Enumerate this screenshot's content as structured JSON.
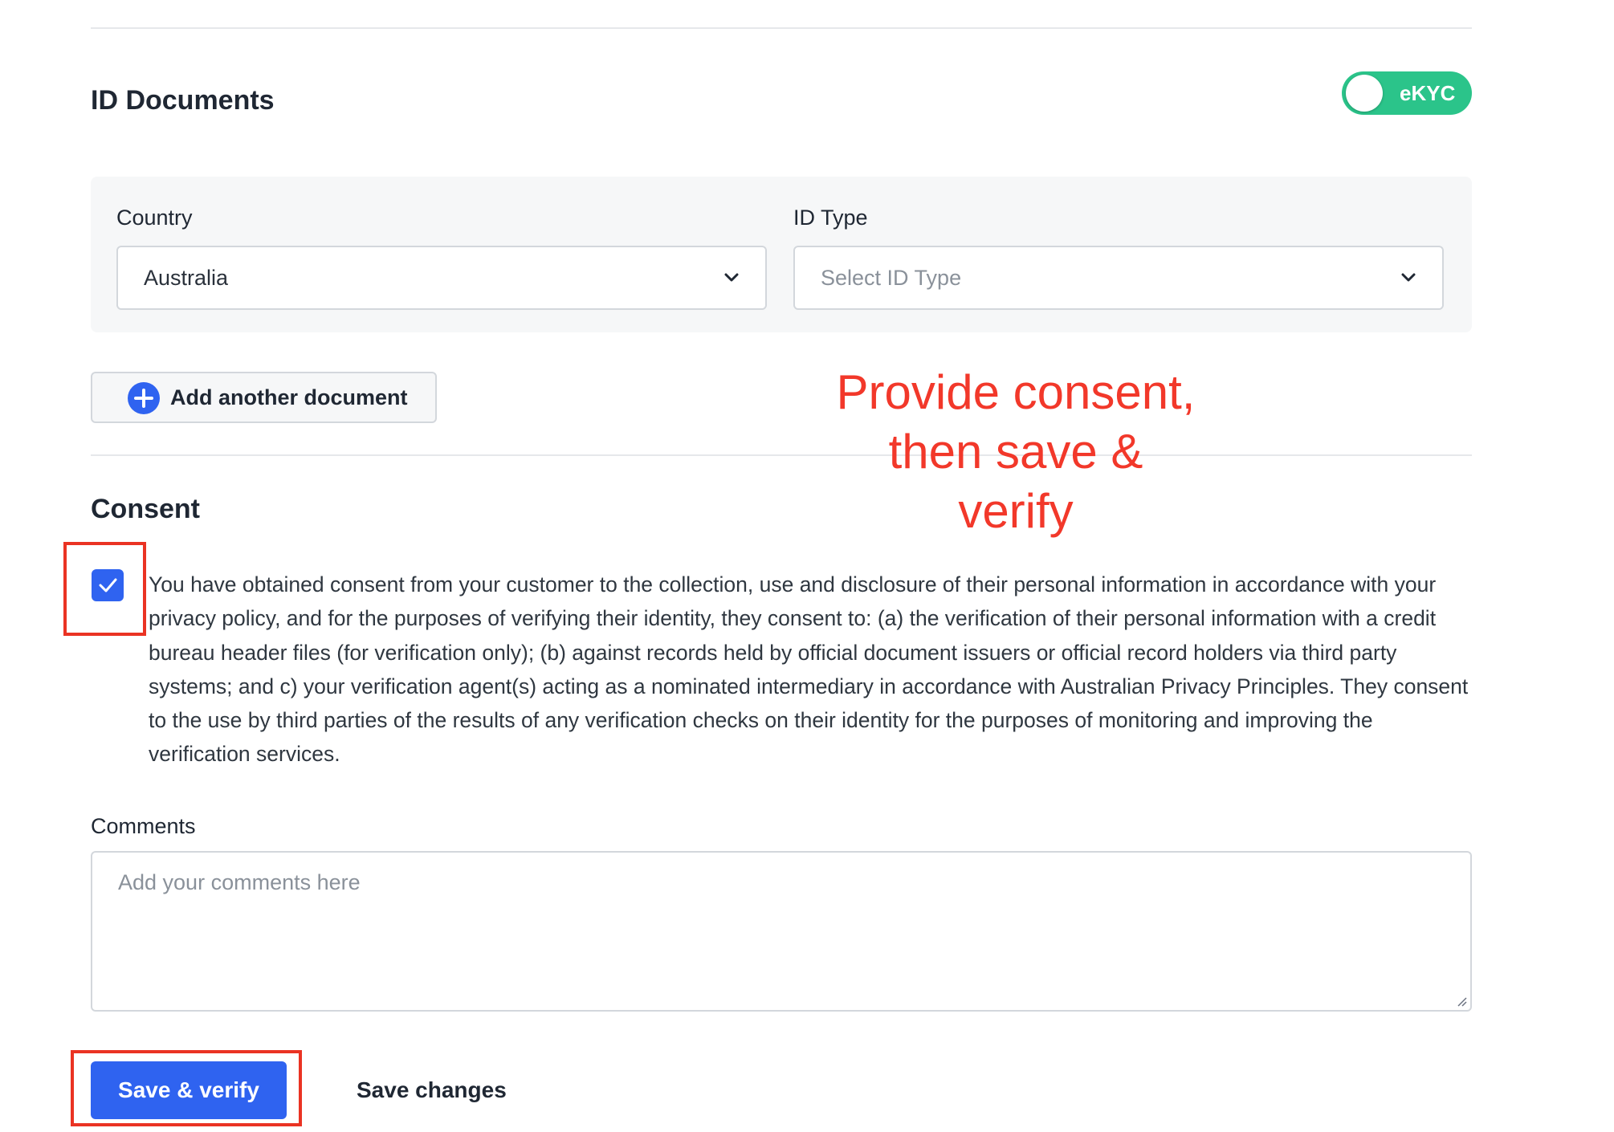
{
  "id_documents": {
    "title": "ID Documents",
    "ekyc_toggle": {
      "label": "eKYC",
      "enabled": true,
      "color": "#2bc48a"
    },
    "country": {
      "label": "Country",
      "value": "Australia"
    },
    "id_type": {
      "label": "ID Type",
      "placeholder": "Select ID Type"
    },
    "add_document_label": "Add another document"
  },
  "annotation": {
    "text": "Provide consent, then save & verify",
    "color": "#f2382a"
  },
  "consent": {
    "title": "Consent",
    "checked": true,
    "text": "You have obtained consent from your customer to the collection, use and disclosure of their personal information in accordance with your privacy policy, and for the purposes of verifying their identity, they consent to: (a) the verification of their personal information with a credit bureau header files (for verification only); (b) against records held by official document issuers or official record holders via third party systems; and c) your verification agent(s) acting as a nominated intermediary in accordance with Australian Privacy Principles. They consent to the use by third parties of the results of any verification checks on their identity for the purposes of monitoring and improving the verification services."
  },
  "comments": {
    "label": "Comments",
    "placeholder": "Add your comments here"
  },
  "actions": {
    "primary_label": "Save & verify",
    "secondary_label": "Save changes",
    "primary_color": "#2f63f0"
  }
}
